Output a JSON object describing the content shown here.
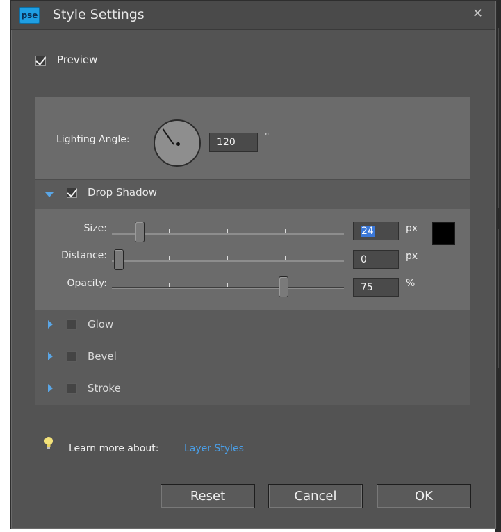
{
  "window": {
    "app_logo": "pse",
    "title": "Style Settings",
    "close_icon": "✕"
  },
  "preview": {
    "label": "Preview",
    "checked": true
  },
  "lighting": {
    "label": "Lighting Angle:",
    "value": "120",
    "unit": "°"
  },
  "sections": {
    "drop_shadow": {
      "label": "Drop Shadow",
      "checked": true,
      "expanded": true,
      "size": {
        "label": "Size:",
        "value": "24",
        "unit": "px"
      },
      "distance": {
        "label": "Distance:",
        "value": "0",
        "unit": "px"
      },
      "opacity": {
        "label": "Opacity:",
        "value": "75",
        "unit": "%"
      },
      "color": "#000000"
    },
    "glow": {
      "label": "Glow",
      "checked": false,
      "expanded": false
    },
    "bevel": {
      "label": "Bevel",
      "checked": false,
      "expanded": false
    },
    "stroke": {
      "label": "Stroke",
      "checked": false,
      "expanded": false
    }
  },
  "footer": {
    "learn_text": "Learn more about:",
    "learn_link": "Layer Styles",
    "reset": "Reset",
    "cancel": "Cancel",
    "ok": "OK"
  },
  "colors": {
    "accent": "#5aa6e6",
    "link": "#4a9fe8",
    "selection": "#3b78d8",
    "dialog_bg": "#535353"
  }
}
